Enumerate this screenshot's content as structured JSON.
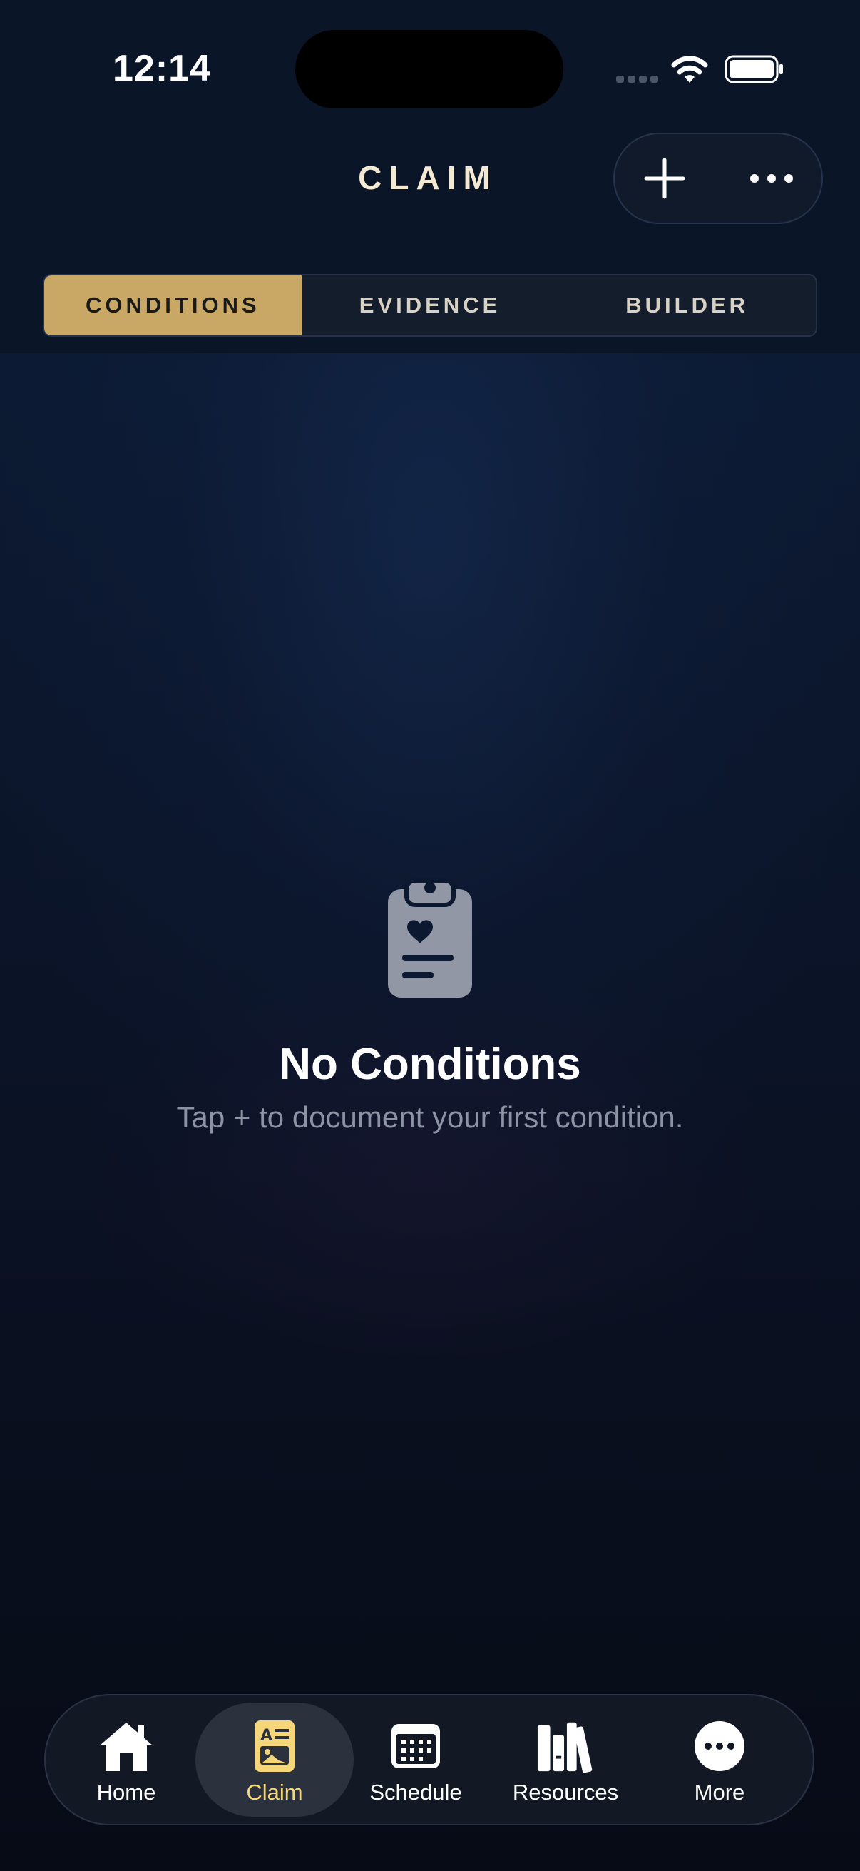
{
  "status_bar": {
    "time": "12:14"
  },
  "header": {
    "title": "CLAIM",
    "add_icon": "plus-icon",
    "more_icon": "ellipsis-icon"
  },
  "segments": [
    {
      "label": "CONDITIONS",
      "active": true
    },
    {
      "label": "EVIDENCE",
      "active": false
    },
    {
      "label": "BUILDER",
      "active": false
    }
  ],
  "empty_state": {
    "icon": "clipboard-heart-icon",
    "title": "No Conditions",
    "subtitle": "Tap + to document your first condition."
  },
  "tab_bar": [
    {
      "label": "Home",
      "icon": "house-icon",
      "active": false
    },
    {
      "label": "Claim",
      "icon": "document-icon",
      "active": true
    },
    {
      "label": "Schedule",
      "icon": "calendar-icon",
      "active": false
    },
    {
      "label": "Resources",
      "icon": "books-icon",
      "active": false
    },
    {
      "label": "More",
      "icon": "ellipsis-circle-icon",
      "active": false
    }
  ],
  "colors": {
    "accent_gold": "#c9a866",
    "active_tab_gold": "#f5d77a",
    "background": "#0b1528"
  }
}
